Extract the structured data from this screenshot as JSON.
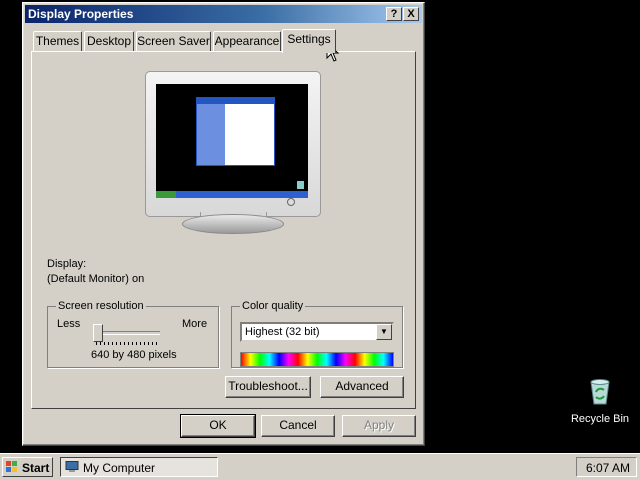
{
  "window": {
    "title": "Display Properties",
    "help_btn": "?",
    "close_btn": "X"
  },
  "tabs": [
    {
      "label": "Themes"
    },
    {
      "label": "Desktop"
    },
    {
      "label": "Screen Saver"
    },
    {
      "label": "Appearance"
    },
    {
      "label": "Settings",
      "active": true
    }
  ],
  "settings": {
    "display_label": "Display:",
    "display_value": "(Default Monitor) on",
    "resolution": {
      "title": "Screen resolution",
      "less": "Less",
      "more": "More",
      "value": "640 by 480 pixels",
      "slider_position": 0
    },
    "color": {
      "title": "Color quality",
      "selected": "Highest (32 bit)"
    },
    "troubleshoot_label": "Troubleshoot...",
    "advanced_label": "Advanced"
  },
  "buttons": {
    "ok": "OK",
    "cancel": "Cancel",
    "apply": "Apply"
  },
  "desktop": {
    "recycle_bin": "Recycle Bin"
  },
  "taskbar": {
    "start": "Start",
    "task": "My Computer",
    "clock": "6:07 AM"
  },
  "colors": {
    "titlebar_start": "#0a246a",
    "titlebar_end": "#a6caf0",
    "face": "#d4d0c8",
    "desktop": "#000000"
  }
}
